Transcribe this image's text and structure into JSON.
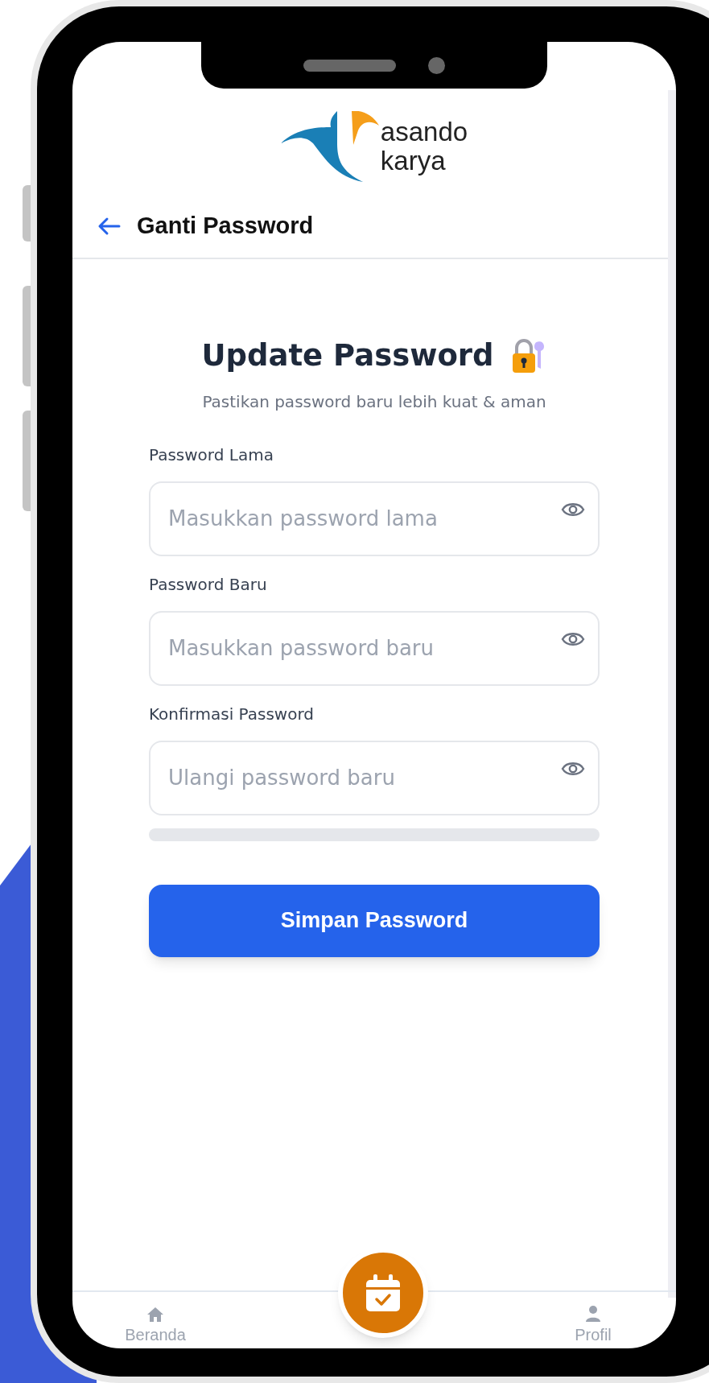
{
  "logo": {
    "lines": [
      "asando",
      "karya"
    ]
  },
  "header": {
    "title": "Ganti Password"
  },
  "form": {
    "title": "Update Password",
    "subtitle": "Pastikan password baru lebih kuat & aman",
    "fields": [
      {
        "label": "Password Lama",
        "placeholder": "Masukkan password lama"
      },
      {
        "label": "Password Baru",
        "placeholder": "Masukkan password baru"
      },
      {
        "label": "Konfirmasi Password",
        "placeholder": "Ulangi password baru"
      }
    ],
    "strength_meter": {
      "level": 0
    },
    "submit": "Simpan Password"
  },
  "bottom_nav": [
    {
      "label": "Beranda",
      "kind": "home"
    },
    {
      "label": "Profil",
      "kind": "profile"
    }
  ]
}
